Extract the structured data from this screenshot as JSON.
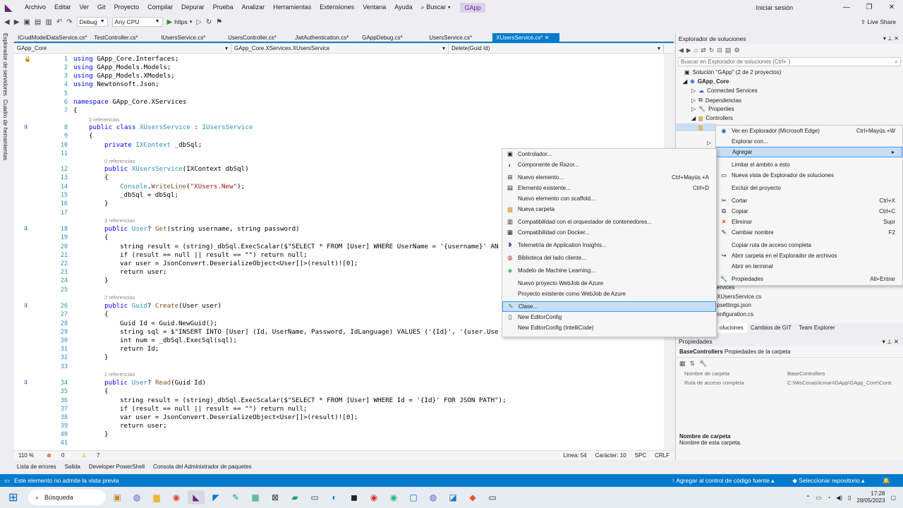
{
  "menubar": {
    "items": [
      "Archivo",
      "Editar",
      "Ver",
      "Git",
      "Proyecto",
      "Compilar",
      "Depurar",
      "Prueba",
      "Analizar",
      "Herramientas",
      "Extensiones",
      "Ventana",
      "Ayuda"
    ],
    "search": "Buscar",
    "solution_badge": "GApp",
    "signin": "Iniciar sesión"
  },
  "toolbar": {
    "config": "Debug",
    "platform": "Any CPU",
    "run_target": "https",
    "liveshare": "Live Share"
  },
  "leftstrip": {
    "server_explorer": "Explorador de servidores",
    "toolbox": "Cuadro de herramientas"
  },
  "tabs": [
    "ICrudModelDataService.cs*",
    "TestController.cs*",
    "IUsersService.cs*",
    "UsersController.cs*",
    "JwtAuthentication.cs*",
    "GAppDebug.cs*",
    "UsersService.cs*",
    "XUsersService.cs*"
  ],
  "navbar": {
    "project": "GApp_Core",
    "class": "GApp_Core.XServices.XUsersService",
    "member": "Delete(Guid Id)"
  },
  "code": {
    "l1": "1",
    "l2": "2",
    "l3": "3",
    "l4": "4",
    "l5": "5",
    "l6": "6",
    "l7": "7",
    "l8": "8",
    "l9": "9",
    "l10": "10",
    "l11": "11",
    "l12": "12",
    "l13": "13",
    "l14": "14",
    "l15": "15",
    "l16": "16",
    "l17": "17",
    "l18": "18",
    "l19": "19",
    "l20": "20",
    "l21": "21",
    "l22": "22",
    "l23": "23",
    "l24": "24",
    "l25": "25",
    "l26": "26",
    "l27": "27",
    "l28": "28",
    "l29": "29",
    "l30": "30",
    "l31": "31",
    "l32": "32",
    "l33": "33",
    "l34": "34",
    "l35": "35",
    "l36": "36",
    "l37": "37",
    "l38": "38",
    "l39": "39",
    "l40": "40",
    "l41": "41",
    "using": "using",
    "ns1": " GApp_Core.Interfaces;",
    "ns2": " GApp_Models.Models;",
    "ns3": " GApp_Models.XModels;",
    "ns4": " Newtonsoft.Json;",
    "namespace_kw": "namespace",
    "namespace_name": " GApp_Core.XServices",
    "brace_open": "{",
    "brace_close": "}",
    "ref2": "2 referencias",
    "ref0": "0 referencias",
    "ref3": "3 referencias",
    "public": "public",
    "class_kw": "class",
    "class_name": "XUsersService",
    "colon": " : ",
    "iface": "IUsersService",
    "private": "private",
    "ictx": "IXContext",
    "field": " _dbSql;",
    "ctor_args": "(IXContext dbSql)",
    "console": "Console",
    "writeline": "WriteLine",
    "xusers_new": "\"XUsers.New\"",
    "assign_db": "_dbSql = dbSql;",
    "user": "User",
    "get": "Get",
    "get_params": "(string username, string password)",
    "l20_code": "string result = (string)_dbSql.ExecScalar($\"SELECT * FROM [User] WHERE UserName = '{username}' AN",
    "l21_code": "if (result == null || result == \"\") return null;",
    "l22_code": "var user = JsonConvert.DeserializeObject<User[]>(result)![0];",
    "return_user": "return user;",
    "guid": "Guid",
    "create": "Create",
    "create_params": "(User user)",
    "l28_code": "Guid Id = Guid.NewGuid();",
    "l29_code": "string sql = $\"INSERT INTO [User] (Id, UserName, Password, IdLanguage) VALUES ('{Id}', '{user.Use",
    "l30_code": "int num = _dbSql.ExecSql(sql);",
    "return_id": "return Id;",
    "read": "Read",
    "read_params": "(Guid Id)",
    "l36_code": "string result = (string)_dbSql.ExecScalar($\"SELECT * FROM [User] WHERE Id = '{Id}' FOR JSON PATH\");"
  },
  "edstatus": {
    "zoom": "110 %",
    "errors": "0",
    "warnings": "7",
    "line": "Línea: 54",
    "char": "Carácter: 10",
    "spc": "SPC",
    "crlf": "CRLF"
  },
  "bottomtabs": [
    "Lista de errores",
    "Salida",
    "Developer PowerShell",
    "Consola del Administrador de paquetes"
  ],
  "statusbar": {
    "left": "Este elemento no admite la vista previa",
    "source": "Agregar al control de código fuente",
    "repo": "Seleccionar repositorio"
  },
  "taskbar": {
    "search": "Búsqueda",
    "time": "17:28",
    "date": "28/05/2023"
  },
  "solexp": {
    "title": "Explorador de soluciones",
    "search": "Buscar en Explorador de soluciones (Ctrl+`)",
    "solution": "Solución \"GApp\" (2 de 2 proyectos)",
    "project": "GApp_Core",
    "connected": "Connected Services",
    "deps": "Dependencias",
    "props": "Properties",
    "controllers": "Controllers",
    "partial1": "ervices",
    "partial2": "XUsersService.cs",
    "partial3": "psettings.json",
    "partial4": "onfiguration.cs",
    "partial5": "Host config",
    "tabs": [
      "oluciones",
      "Cambios de GIT",
      "Team Explorer"
    ]
  },
  "properties": {
    "title": "Propiedades",
    "selected": "BaseControllers",
    "selected_desc": "Propiedades de la carpeta",
    "rows": [
      {
        "k": "Nombre de carpeta",
        "v": "BaseControllers"
      },
      {
        "k": "Ruta de acceso completa",
        "v": "C:\\MisCosas\\tcman\\GApp\\GApp_Core\\Contr"
      }
    ],
    "desc_title": "Nombre de carpeta",
    "desc_text": "Nombre de esta carpeta."
  },
  "menu_main": [
    {
      "label": "Ver en Explorador (Microsoft Edge)",
      "shortcut": "Ctrl+Mayús.+W"
    },
    {
      "label": "Explorar con...",
      "shortcut": ""
    },
    {
      "label": "Agregar",
      "shortcut": "▸"
    },
    {
      "label": "Limitar el ámbito a esto",
      "shortcut": ""
    },
    {
      "label": "Nueva vista de Explorador de soluciones",
      "shortcut": ""
    },
    {
      "label": "Excluir del proyecto",
      "shortcut": ""
    },
    {
      "label": "Cortar",
      "shortcut": "Ctrl+X"
    },
    {
      "label": "Copiar",
      "shortcut": "Ctrl+C"
    },
    {
      "label": "Eliminar",
      "shortcut": "Supr"
    },
    {
      "label": "Cambiar nombre",
      "shortcut": "F2"
    },
    {
      "label": "Copiar ruta de acceso completa",
      "shortcut": ""
    },
    {
      "label": "Abrir carpeta en el Explorador de archivos",
      "shortcut": ""
    },
    {
      "label": "Abrir en terminal",
      "shortcut": ""
    },
    {
      "label": "Propiedades",
      "shortcut": "Alt+Entrar"
    }
  ],
  "menu_add": [
    {
      "label": "Controlador...",
      "shortcut": ""
    },
    {
      "label": "Componente de Razor...",
      "shortcut": ""
    },
    {
      "label": "Nuevo elemento...",
      "shortcut": "Ctrl+Mayús.+A"
    },
    {
      "label": "Elemento existente...",
      "shortcut": "Ctrl+D"
    },
    {
      "label": "Nuevo elemento con scaffold...",
      "shortcut": ""
    },
    {
      "label": "Nueva carpeta",
      "shortcut": ""
    },
    {
      "label": "Compatibilidad con el orquestador de contenedores...",
      "shortcut": ""
    },
    {
      "label": "Compatibilidad con Docker...",
      "shortcut": ""
    },
    {
      "label": "Telemetría de Application Insights...",
      "shortcut": ""
    },
    {
      "label": "Biblioteca del lado cliente...",
      "shortcut": ""
    },
    {
      "label": "Modelo de Machine Learning...",
      "shortcut": ""
    },
    {
      "label": "Nuevo proyecto WebJob de Azure",
      "shortcut": ""
    },
    {
      "label": "Proyecto existente como WebJob de Azure",
      "shortcut": ""
    },
    {
      "label": "Clase...",
      "shortcut": ""
    },
    {
      "label": "New EditorConfig",
      "shortcut": ""
    },
    {
      "label": "New EditorConfig (IntelliCode)",
      "shortcut": ""
    }
  ]
}
